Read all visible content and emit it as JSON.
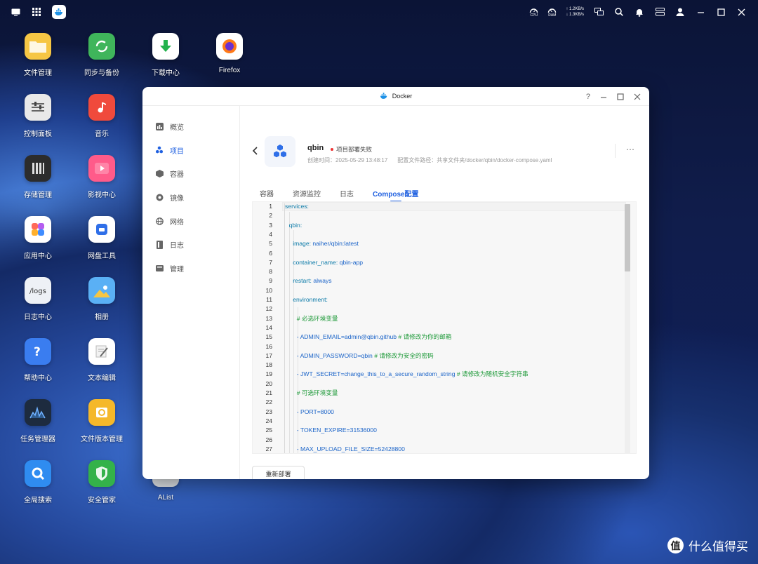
{
  "topbar": {
    "cpu_label": "CPU",
    "ram_label": "RAM",
    "net_up": "↑ 1.2KB/s",
    "net_down": "↓ 1.3KB/s"
  },
  "desktop_icons": [
    {
      "label": "文件管理",
      "icon": "folder-icon",
      "color": "#f6c644"
    },
    {
      "label": "同步与备份",
      "icon": "sync-icon",
      "color": "#3fb55b"
    },
    {
      "label": "下载中心",
      "icon": "download-icon",
      "color": "#ffffff"
    },
    {
      "label": "Firefox",
      "icon": "firefox-icon",
      "color": "#ffffff"
    },
    {
      "label": "控制面板",
      "icon": "sliders-icon",
      "color": "#e9e9e9"
    },
    {
      "label": "音乐",
      "icon": "music-icon",
      "color": "#f04a3c"
    },
    {
      "label": "存储管理",
      "icon": "storage-icon",
      "color": "#2c2c2c"
    },
    {
      "label": "影视中心",
      "icon": "video-icon",
      "color": "#ff5b8a"
    },
    {
      "label": "应用中心",
      "icon": "apps-icon",
      "color": "#ffffff"
    },
    {
      "label": "网盘工具",
      "icon": "cloud-drive-icon",
      "color": "#ffffff"
    },
    {
      "label": "日志中心",
      "icon": "logs-icon",
      "color": "#eef1f6"
    },
    {
      "label": "相册",
      "icon": "photo-icon",
      "color": "#5ab0f5"
    },
    {
      "label": "帮助中心",
      "icon": "help-icon",
      "color": "#3a7df0"
    },
    {
      "label": "文本编辑",
      "icon": "text-edit-icon",
      "color": "#ffffff"
    },
    {
      "label": "任务管理器",
      "icon": "task-manager-icon",
      "color": "#1d2b3f"
    },
    {
      "label": "文件版本管理",
      "icon": "file-version-icon",
      "color": "#f5b82a"
    },
    {
      "label": "全局搜索",
      "icon": "global-search-icon",
      "color": "#2f8cf0"
    },
    {
      "label": "安全管家",
      "icon": "security-icon",
      "color": "#34b24a"
    },
    {
      "label": "AList",
      "icon": "alist-icon",
      "color": "#e8ecef"
    }
  ],
  "window": {
    "title": "Docker",
    "controls": {
      "help": "?"
    }
  },
  "sidebar": {
    "items": [
      {
        "label": "概览",
        "icon": "overview-icon"
      },
      {
        "label": "项目",
        "icon": "project-icon"
      },
      {
        "label": "容器",
        "icon": "container-icon"
      },
      {
        "label": "镜像",
        "icon": "image-icon"
      },
      {
        "label": "网络",
        "icon": "network-icon"
      },
      {
        "label": "日志",
        "icon": "log-icon"
      },
      {
        "label": "管理",
        "icon": "manage-icon"
      }
    ],
    "active": "项目"
  },
  "project": {
    "name": "qbin",
    "status": "项目部署失败",
    "created": "创建时间：2025-05-29 13:48:17",
    "config_path": "配置文件路径：共享文件夹/docker/qbin/docker-compose.yaml"
  },
  "tabs": [
    {
      "label": "容器"
    },
    {
      "label": "资源监控"
    },
    {
      "label": "日志"
    },
    {
      "label": "Compose配置"
    }
  ],
  "active_tab": "Compose配置",
  "editor": {
    "lines": [
      {
        "n": "1",
        "indent": 0,
        "parts": [
          {
            "t": "services:",
            "c": "k"
          }
        ]
      },
      {
        "n": "2",
        "indent": 0,
        "parts": []
      },
      {
        "n": "3",
        "indent": 1,
        "parts": [
          {
            "t": "qbin:",
            "c": "k"
          }
        ]
      },
      {
        "n": "4",
        "indent": 0,
        "parts": []
      },
      {
        "n": "5",
        "indent": 2,
        "parts": [
          {
            "t": "image: ",
            "c": "k"
          },
          {
            "t": "naiher/qbin:latest",
            "c": "v"
          }
        ]
      },
      {
        "n": "6",
        "indent": 0,
        "parts": []
      },
      {
        "n": "7",
        "indent": 2,
        "parts": [
          {
            "t": "container_name: ",
            "c": "k"
          },
          {
            "t": "qbin-app",
            "c": "v"
          }
        ]
      },
      {
        "n": "8",
        "indent": 0,
        "parts": []
      },
      {
        "n": "9",
        "indent": 2,
        "parts": [
          {
            "t": "restart: ",
            "c": "k"
          },
          {
            "t": "always",
            "c": "v"
          }
        ]
      },
      {
        "n": "10",
        "indent": 0,
        "parts": []
      },
      {
        "n": "11",
        "indent": 2,
        "parts": [
          {
            "t": "environment:",
            "c": "k"
          }
        ]
      },
      {
        "n": "12",
        "indent": 0,
        "parts": []
      },
      {
        "n": "13",
        "indent": 3,
        "parts": [
          {
            "t": "# 必选环境变量",
            "c": "c"
          }
        ]
      },
      {
        "n": "14",
        "indent": 0,
        "parts": []
      },
      {
        "n": "15",
        "indent": 3,
        "parts": [
          {
            "t": "- ADMIN_EMAIL=admin@qbin.github  ",
            "c": "v"
          },
          {
            "t": "# 请修改为你的邮箱",
            "c": "c"
          }
        ]
      },
      {
        "n": "16",
        "indent": 0,
        "parts": []
      },
      {
        "n": "17",
        "indent": 3,
        "parts": [
          {
            "t": "- ADMIN_PASSWORD=qbin  ",
            "c": "v"
          },
          {
            "t": "# 请修改为安全的密码",
            "c": "c"
          }
        ]
      },
      {
        "n": "18",
        "indent": 0,
        "parts": []
      },
      {
        "n": "19",
        "indent": 3,
        "parts": [
          {
            "t": "- JWT_SECRET=change_this_to_a_secure_random_string  ",
            "c": "v"
          },
          {
            "t": "# 请修改为随机安全字符串",
            "c": "c"
          }
        ]
      },
      {
        "n": "20",
        "indent": 0,
        "parts": []
      },
      {
        "n": "21",
        "indent": 3,
        "parts": [
          {
            "t": "# 可选环境变量",
            "c": "c"
          }
        ]
      },
      {
        "n": "22",
        "indent": 0,
        "parts": []
      },
      {
        "n": "23",
        "indent": 3,
        "parts": [
          {
            "t": "- PORT=8000",
            "c": "v"
          }
        ]
      },
      {
        "n": "24",
        "indent": 0,
        "parts": []
      },
      {
        "n": "25",
        "indent": 3,
        "parts": [
          {
            "t": "- TOKEN_EXPIRE=31536000",
            "c": "v"
          }
        ]
      },
      {
        "n": "26",
        "indent": 0,
        "parts": []
      },
      {
        "n": "27",
        "indent": 3,
        "parts": [
          {
            "t": "- MAX_UPLOAD_FILE_SIZE=52428800",
            "c": "v"
          }
        ]
      }
    ]
  },
  "redeploy_button": "重新部署",
  "watermark": {
    "badge": "值",
    "text": "什么值得买"
  }
}
